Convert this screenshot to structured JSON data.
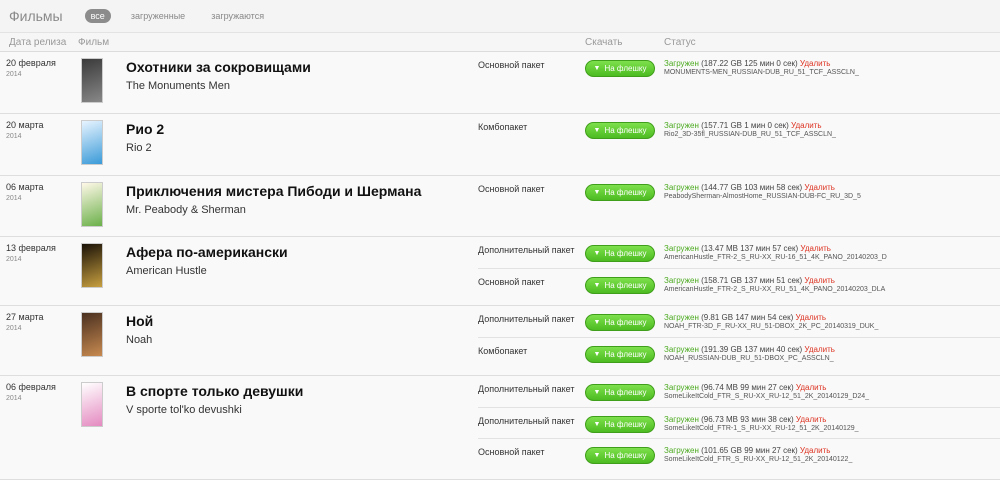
{
  "header": {
    "title": "Фильмы",
    "filters": [
      "все",
      "загруженные",
      "загружаются"
    ],
    "columns": {
      "date": "Дата релиза",
      "film": "Фильм",
      "download": "Скачать",
      "status": "Статус"
    }
  },
  "button_label": "На флешку",
  "status_loaded": "Загружен",
  "delete_label": "Удалить",
  "films": [
    {
      "date": "20 февраля",
      "year": "2014",
      "title_ru": "Охотники за сокровищами",
      "title_en": "The Monuments Men",
      "packages": [
        {
          "label": "Основной пакет",
          "info": "(187.22 GB 125 мин 0 сек)",
          "file": "MONUMENTS-MEN_RUSSIAN-DUB_RU_51_TCF_ASSCLN_"
        }
      ]
    },
    {
      "date": "20 марта",
      "year": "2014",
      "title_ru": "Рио 2",
      "title_en": "Rio 2",
      "packages": [
        {
          "label": "Комбопакет",
          "info": "(157.71 GB 1 мин 0 сек)",
          "file": "Rio2_3D-35fl_RUSSIAN-DUB_RU_51_TCF_ASSCLN_"
        }
      ]
    },
    {
      "date": "06 марта",
      "year": "2014",
      "title_ru": "Приключения мистера Пибоди и Шермана",
      "title_en": "Mr. Peabody & Sherman",
      "packages": [
        {
          "label": "Основной пакет",
          "info": "(144.77 GB 103 мин 58 сек)",
          "file": "PeabodySherman-AlmostHome_RUSSIAN-DUB-FC_RU_3D_5"
        }
      ]
    },
    {
      "date": "13 февраля",
      "year": "2014",
      "title_ru": "Афера по-американски",
      "title_en": "American Hustle",
      "packages": [
        {
          "label": "Дополнительный пакет",
          "info": "(13.47 MB 137 мин 57 сек)",
          "file": "AmericanHustle_FTR-2_S_RU-XX_RU-16_51_4K_PANO_20140203_D"
        },
        {
          "label": "Основной пакет",
          "info": "(158.71 GB 137 мин 51 сек)",
          "file": "AmericanHustle_FTR-2_S_RU-XX_RU_51_4K_PANO_20140203_DLA"
        }
      ]
    },
    {
      "date": "27 марта",
      "year": "2014",
      "title_ru": "Ной",
      "title_en": "Noah",
      "packages": [
        {
          "label": "Дополнительный пакет",
          "info": "(9.81 GB 147 мин 54 сек)",
          "file": "NOAH_FTR-3D_F_RU-XX_RU_51-DBOX_2K_PC_20140319_DUK_"
        },
        {
          "label": "Комбопакет",
          "info": "(191.39 GB 137 мин 40 сек)",
          "file": "NOAH_RUSSIAN-DUB_RU_51-DBOX_PC_ASSCLN_"
        }
      ]
    },
    {
      "date": "06 февраля",
      "year": "2014",
      "title_ru": "В спорте только девушки",
      "title_en": "V sporte tol'ko devushki",
      "packages": [
        {
          "label": "Дополнительный пакет",
          "info": "(96.74 MB 99 мин 27 сек)",
          "file": "SomeLikeItCold_FTR_S_RU-XX_RU-12_51_2K_20140129_D24_"
        },
        {
          "label": "Дополнительный пакет",
          "info": "(96.73 MB 93 мин 38 сек)",
          "file": "SomeLikeItCold_FTR-1_S_RU-XX_RU-12_51_2K_20140129_"
        },
        {
          "label": "Основной пакет",
          "info": "(101.65 GB 99 мин 27 сек)",
          "file": "SomeLikeItCold_FTR_S_RU-XX_RU-12_51_2K_20140122_"
        }
      ]
    }
  ]
}
